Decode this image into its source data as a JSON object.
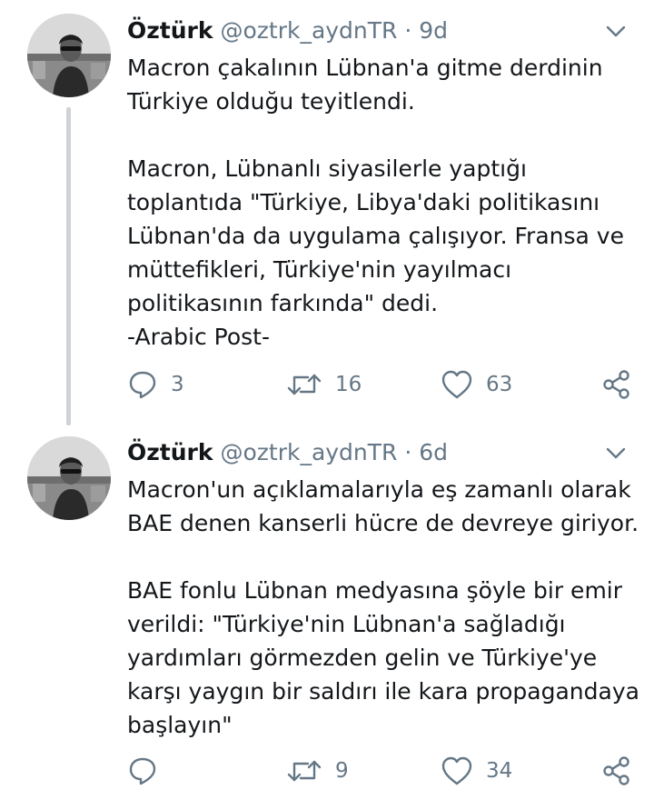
{
  "tweets": [
    {
      "display_name": "Öztürk",
      "handle": "@oztrk_aydnTR",
      "separator": "·",
      "time": "9d",
      "paragraphs": [
        "Macron çakalının Lübnan'a gitme derdinin\nTürkiye olduğu teyitlendi.",
        "Macron, Lübnanlı siyasilerle yaptığı\ntoplantıda \"Türkiye, Libya'daki politikasını\nLübnan'da da uygulama çalışıyor. Fransa ve\nmüttefikleri, Türkiye'nin yayılmacı\npolitikasının farkında\" dedi.\n-Arabic Post-"
      ],
      "replies": "3",
      "retweets": "16",
      "likes": "63"
    },
    {
      "display_name": "Öztürk",
      "handle": "@oztrk_aydnTR",
      "separator": "·",
      "time": "6d",
      "paragraphs": [
        "Macron'un açıklamalarıyla eş zamanlı olarak\nBAE denen kanserli hücre de devreye giriyor.",
        "BAE fonlu Lübnan medyasına şöyle bir emir\nverildi: \"Türkiye'nin Lübnan'a sağladığı\nyardımları görmezden gelin ve Türkiye'ye\nkarşı yaygın bir saldırı ile kara propagandaya\nbaşlayın\""
      ],
      "replies": "",
      "retweets": "9",
      "likes": "34"
    }
  ],
  "icons": {
    "reply": "reply-icon",
    "retweet": "retweet-icon",
    "like": "heart-icon",
    "share": "share-icon",
    "more": "chevron-down-icon"
  },
  "colors": {
    "text": "#14171a",
    "secondary": "#657786",
    "thread_line": "#cfd3d6"
  }
}
